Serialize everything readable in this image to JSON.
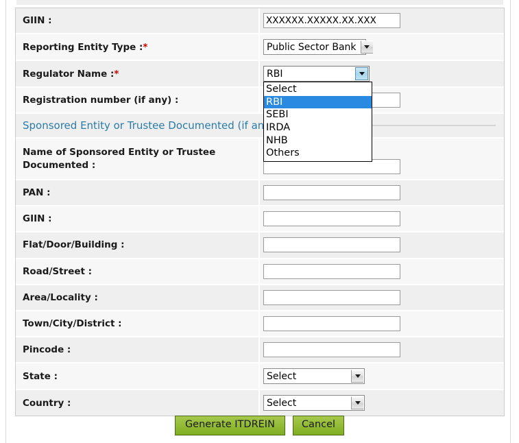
{
  "form": {
    "rows": [
      {
        "label": "GIIN :",
        "required": false,
        "control": "text",
        "value": "XXXXXX.XXXXX.XX.XXX",
        "name": "giin-entity"
      },
      {
        "label": "Reporting Entity Type :",
        "required": true,
        "control": "select",
        "value": "Public Sector Bank",
        "name": "reporting-entity-type"
      },
      {
        "label": "Regulator Name :",
        "required": true,
        "control": "select-open",
        "value": "RBI",
        "name": "regulator-name",
        "options": [
          "Select",
          "RBI",
          "SEBI",
          "IRDA",
          "NHB",
          "Others"
        ],
        "selected_option": "RBI"
      },
      {
        "label": "Registration number (if any) :",
        "required": false,
        "control": "text",
        "value": "",
        "name": "registration-number"
      }
    ],
    "section": {
      "title": "Sponsored Entity or Trustee Documented (if any)",
      "visible_tail": ")"
    },
    "rows2": [
      {
        "label": "Name of Sponsored Entity or Trustee Documented :",
        "required": false,
        "control": "text",
        "value": "",
        "name": "sponsored-entity-name",
        "two_line": true
      },
      {
        "label": "PAN :",
        "required": false,
        "control": "text",
        "value": "",
        "name": "pan"
      },
      {
        "label": "GIIN :",
        "required": false,
        "control": "text",
        "value": "",
        "name": "giin-sponsored"
      },
      {
        "label": "Flat/Door/Building :",
        "required": false,
        "control": "text",
        "value": "",
        "name": "flat-door-building"
      },
      {
        "label": "Road/Street :",
        "required": false,
        "control": "text",
        "value": "",
        "name": "road-street"
      },
      {
        "label": "Area/Locality :",
        "required": false,
        "control": "text",
        "value": "",
        "name": "area-locality"
      },
      {
        "label": "Town/City/District :",
        "required": false,
        "control": "text",
        "value": "",
        "name": "town-city-district"
      },
      {
        "label": "Pincode :",
        "required": false,
        "control": "text",
        "value": "",
        "name": "pincode"
      },
      {
        "label": "State :",
        "required": false,
        "control": "select",
        "value": "Select",
        "name": "state"
      },
      {
        "label": "Country :",
        "required": false,
        "control": "select",
        "value": "Select",
        "name": "country"
      }
    ]
  },
  "buttons": {
    "submit_label": "Generate ITDREIN",
    "cancel_label": "Cancel"
  },
  "colors": {
    "row_odd": "#efefef",
    "row_even": "#f7f7f7",
    "section_title": "#2b7ba8",
    "required_marker": "#cc0000",
    "dropdown_highlight": "#2a8ae2",
    "button_green": "#93bb36"
  }
}
